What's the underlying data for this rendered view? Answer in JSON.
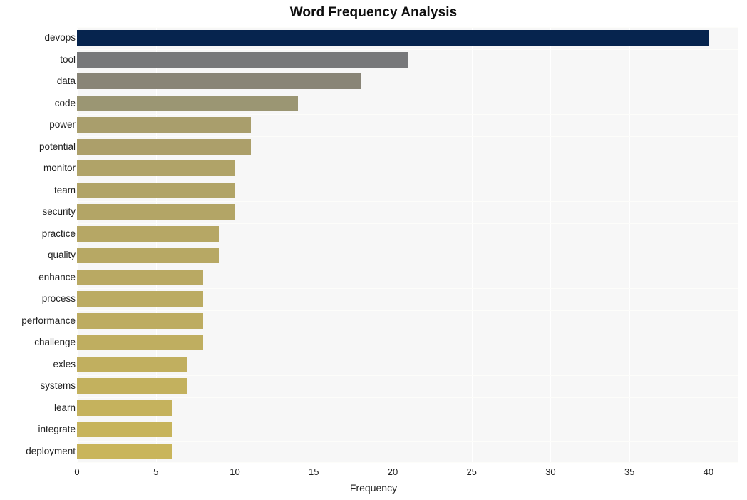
{
  "chart_data": {
    "type": "bar",
    "orientation": "horizontal",
    "title": "Word Frequency Analysis",
    "xlabel": "Frequency",
    "ylabel": "",
    "xlim": [
      0,
      41.9
    ],
    "xticks": [
      0,
      5,
      10,
      15,
      20,
      25,
      30,
      35,
      40
    ],
    "xtick_labels": [
      "0",
      "5",
      "10",
      "15",
      "20",
      "25",
      "30",
      "35",
      "40"
    ],
    "grid": true,
    "legend": "none",
    "categories": [
      "devops",
      "tool",
      "data",
      "code",
      "power",
      "potential",
      "monitor",
      "team",
      "security",
      "practice",
      "quality",
      "enhance",
      "process",
      "performance",
      "challenge",
      "exles",
      "systems",
      "learn",
      "integrate",
      "deployment"
    ],
    "values": [
      40,
      21,
      18,
      14,
      11,
      11,
      10,
      10,
      10,
      9,
      9,
      8,
      8,
      8,
      8,
      7,
      7,
      6,
      6,
      6
    ],
    "bar_colors": [
      "#06244e",
      "#77787a",
      "#898577",
      "#9b9673",
      "#a99e6c",
      "#ac9f6a",
      "#b0a368",
      "#b1a467",
      "#b3a566",
      "#b6a765",
      "#b7a864",
      "#b9a963",
      "#bbab62",
      "#bdac61",
      "#bfae60",
      "#c1af5f",
      "#c3b15e",
      "#c5b25d",
      "#c7b45c",
      "#c9b55b"
    ],
    "plot_background": "#f7f7f7",
    "gridline_color": "#ffffff",
    "text_color": "#1f1f1f"
  }
}
